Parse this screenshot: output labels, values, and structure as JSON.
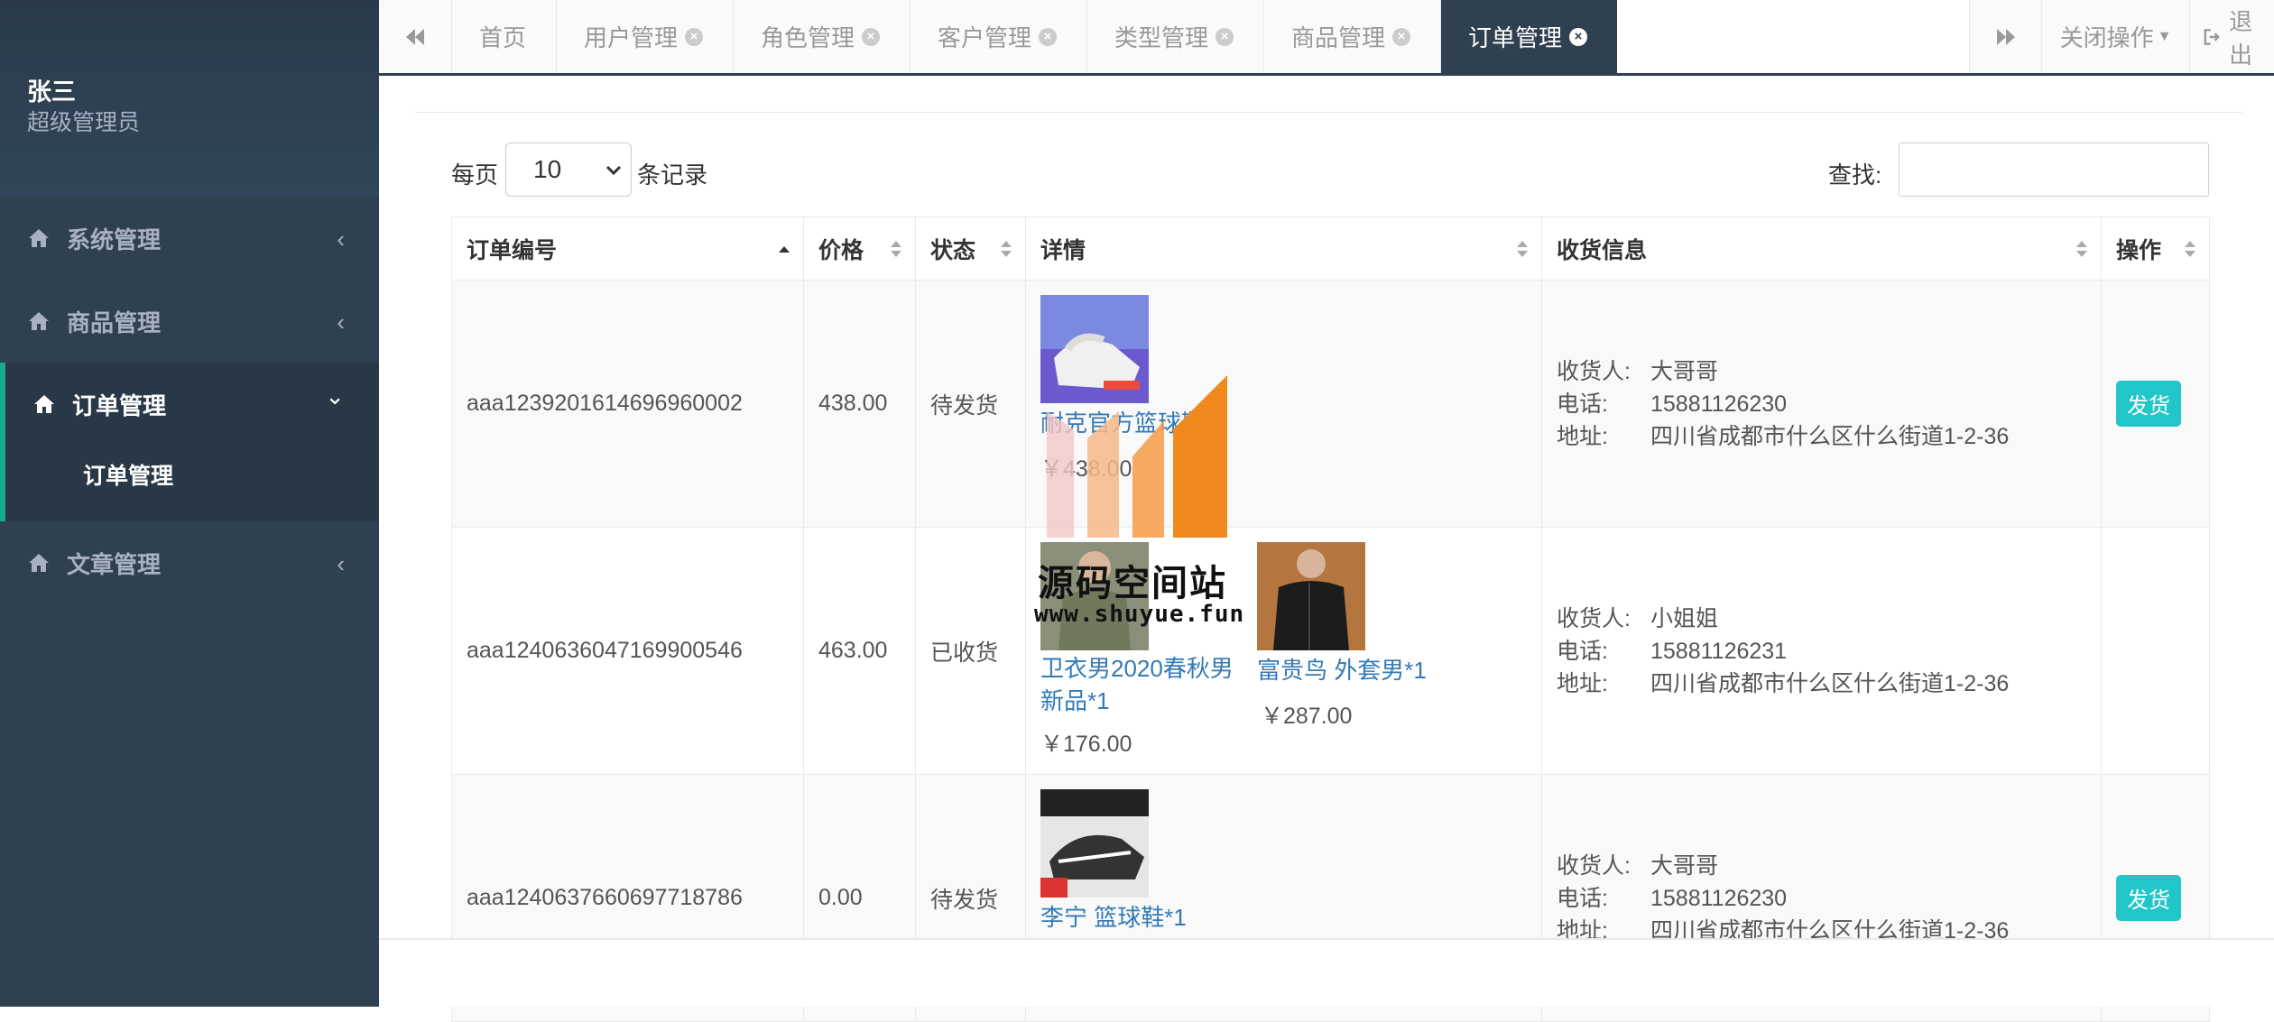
{
  "profile": {
    "name": "张三",
    "role": "超级管理员"
  },
  "sidebar": {
    "items": [
      {
        "label": "系统管理",
        "arrow": "‹"
      },
      {
        "label": "商品管理",
        "arrow": "‹"
      },
      {
        "label": "订单管理",
        "arrow": "⌄"
      },
      {
        "label": "文章管理",
        "arrow": "‹"
      }
    ],
    "subitem": "订单管理"
  },
  "tabs": {
    "items": [
      {
        "label": "首页"
      },
      {
        "label": "用户管理"
      },
      {
        "label": "角色管理"
      },
      {
        "label": "客户管理"
      },
      {
        "label": "类型管理"
      },
      {
        "label": "商品管理"
      },
      {
        "label": "订单管理"
      }
    ],
    "close_ops": "关闭操作",
    "logout": "退出"
  },
  "table_controls": {
    "per_page_label": "每页",
    "per_page_value": "10",
    "per_page_suffix": "条记录",
    "search_label": "查找:"
  },
  "table": {
    "columns": [
      "订单编号",
      "价格",
      "状态",
      "详情",
      "收货信息",
      "操作"
    ],
    "rows": [
      {
        "order_no": "aaa1239201614696960002",
        "price": "438.00",
        "status": "待发货",
        "products": [
          {
            "name": "耐克官方篮球鞋*2",
            "price": "￥438.00"
          }
        ],
        "receiver_label": "收货人:",
        "receiver": "大哥哥",
        "phone_label": "电话:",
        "phone": "15881126230",
        "addr_label": "地址:",
        "addr": "四川省成都市什么区什么街道1-2-36",
        "action": "发货"
      },
      {
        "order_no": "aaa1240636047169900546",
        "price": "463.00",
        "status": "已收货",
        "products": [
          {
            "name": "卫衣男2020春秋男新品*1",
            "price": "￥176.00"
          },
          {
            "name": "富贵鸟 外套男*1",
            "price": "￥287.00"
          }
        ],
        "receiver_label": "收货人:",
        "receiver": "小姐姐",
        "phone_label": "电话:",
        "phone": "15881126231",
        "addr_label": "地址:",
        "addr": "四川省成都市什么区什么街道1-2-36",
        "action": ""
      },
      {
        "order_no": "aaa1240637660697718786",
        "price": "0.00",
        "status": "待发货",
        "products": [
          {
            "name": "李宁 篮球鞋*1",
            "price": ""
          }
        ],
        "receiver_label": "收货人:",
        "receiver": "大哥哥",
        "phone_label": "电话:",
        "phone": "15881126230",
        "addr_label": "地址:",
        "addr": "四川省成都市什么区什么街道1-2-36",
        "action": "发货"
      }
    ]
  },
  "watermark": {
    "text": "源码空间站",
    "url": "www.shuyue.fun"
  },
  "colors": {
    "sidebar": "#2f4050",
    "link": "#337ab7",
    "ship_button": "#23c6c8"
  }
}
